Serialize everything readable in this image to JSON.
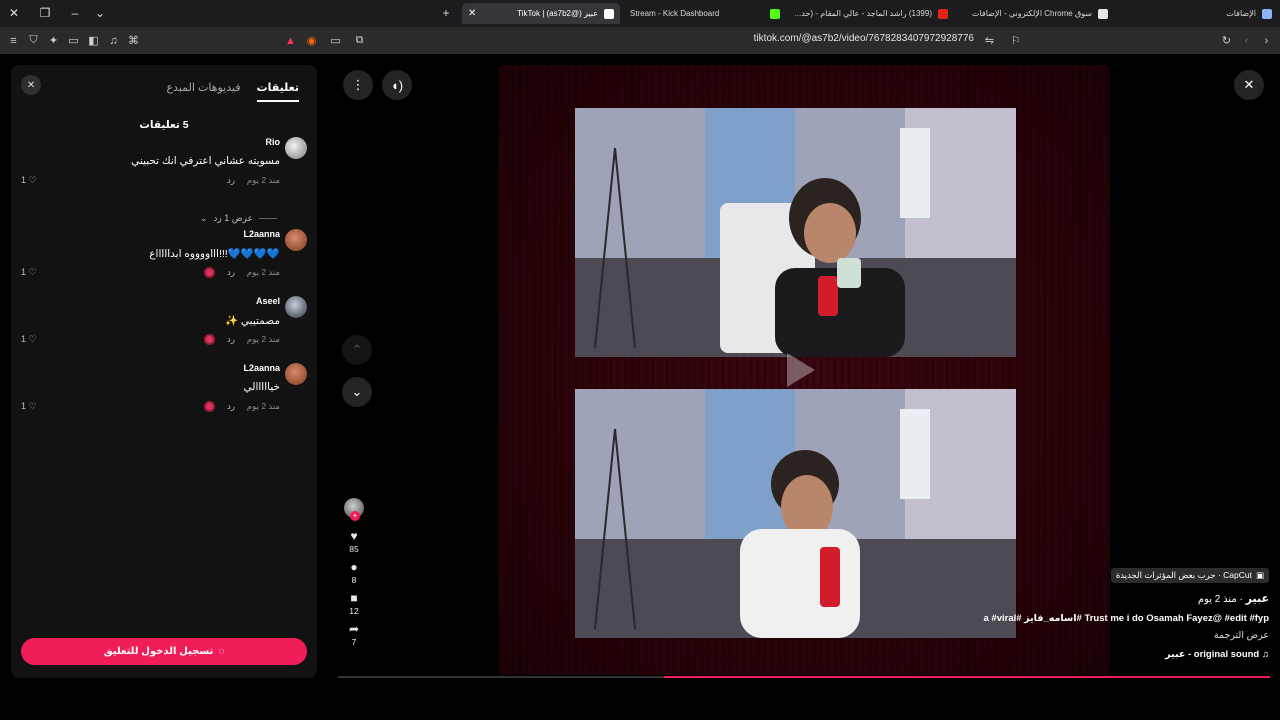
{
  "browser": {
    "tabs": [
      {
        "label": "الإضافات",
        "active": false
      },
      {
        "label": "سوق Chrome الإلكتروني - الإضافات",
        "active": false
      },
      {
        "label": "(1399) راشد الماجد - عالي المقام - (حد...",
        "active": false
      },
      {
        "label": "Stream - Kick Dashboard",
        "active": false
      },
      {
        "label": "عبير (@as7b2) | TikTok",
        "active": true
      }
    ],
    "url": "tiktok.com/@as7b2/video/7678283407972928776"
  },
  "panel": {
    "tab_comments": "تعليقات",
    "tab_creator_videos": "فيديوهات المبدع",
    "count": "5 تعليقات",
    "reply_label": "رد",
    "view_replies": "عرض 1 رد",
    "login": "تسجيل الدخول للتعليق"
  },
  "comments": [
    {
      "user": "Rio",
      "text": "مسويته عشاني اعترفي انك تحبيني",
      "time": "منذ 2 يوم",
      "likes": "1",
      "avatar_color": "#cfcfcf"
    },
    {
      "user": "L2aanna",
      "text": "💙💙💙💙!!!اااووووه ابداااااع",
      "time": "منذ 2 يوم",
      "likes": "1",
      "avatar_color": "#b0573a"
    },
    {
      "user": "Aseel",
      "text": "مصمتيبي ✨",
      "time": "منذ 2 يوم",
      "likes": "1",
      "avatar_color": "#3a4150"
    },
    {
      "user": "L2aanna",
      "text": "خيااااالي",
      "time": "منذ 2 يوم",
      "likes": "1",
      "avatar_color": "#b0573a"
    }
  ],
  "actions": {
    "likes": "85",
    "comments": "8",
    "saves": "12",
    "shares": "7"
  },
  "video": {
    "capcut": "CapCut · جرب بعض المؤثرات الجديدة",
    "author": "عبير",
    "posted": "منذ 2 يوم",
    "caption": "Trust me i do Osamah Fayez@ #edit #fyp #اسامه_فايز #a #viral",
    "translate": "عرض الترجمة",
    "sound": "original sound - عبير",
    "progress": 0.65
  },
  "colors": {
    "accent": "#f01d58",
    "panel_bg": "#121212"
  }
}
